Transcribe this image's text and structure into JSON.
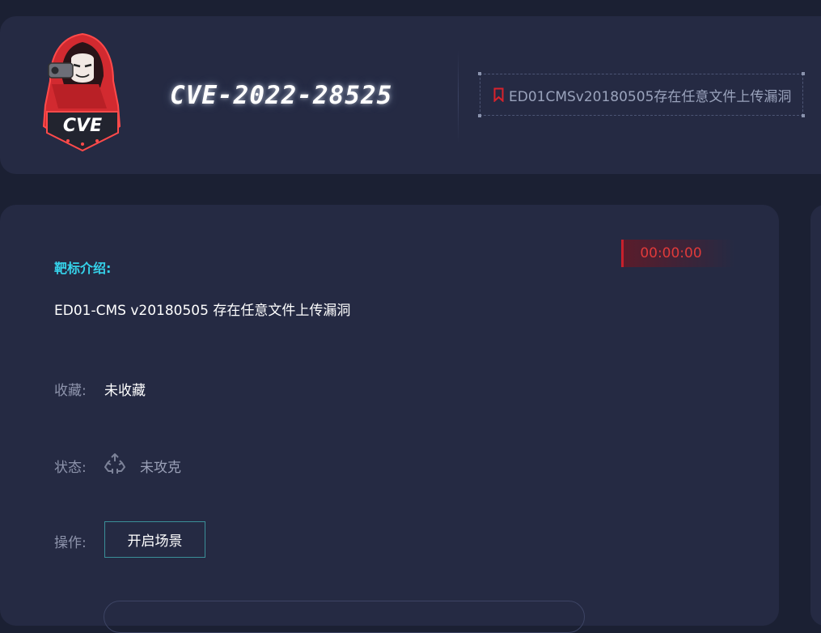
{
  "header": {
    "cve_id": "CVE-2022-28525",
    "vuln_tag": "ED01CMSv20180505存在任意文件上传漏洞",
    "logo_text": "CVE"
  },
  "main": {
    "timer": "00:00:00",
    "intro_label": "靶标介绍:",
    "intro_text": "ED01-CMS v20180505 存在任意文件上传漏洞",
    "favorite_label": "收藏:",
    "favorite_value": "未收藏",
    "status_label": "状态:",
    "status_value": "未攻克",
    "action_label": "操作:",
    "start_button": "开启场景"
  },
  "colors": {
    "background": "#1b2033",
    "card": "#252a43",
    "accent_cyan": "#35d2ea",
    "timer_red": "#e03a3a",
    "button_border": "#3a8f98"
  },
  "icons": [
    "hacker-logo",
    "bookmark-icon",
    "recycle-icon"
  ]
}
